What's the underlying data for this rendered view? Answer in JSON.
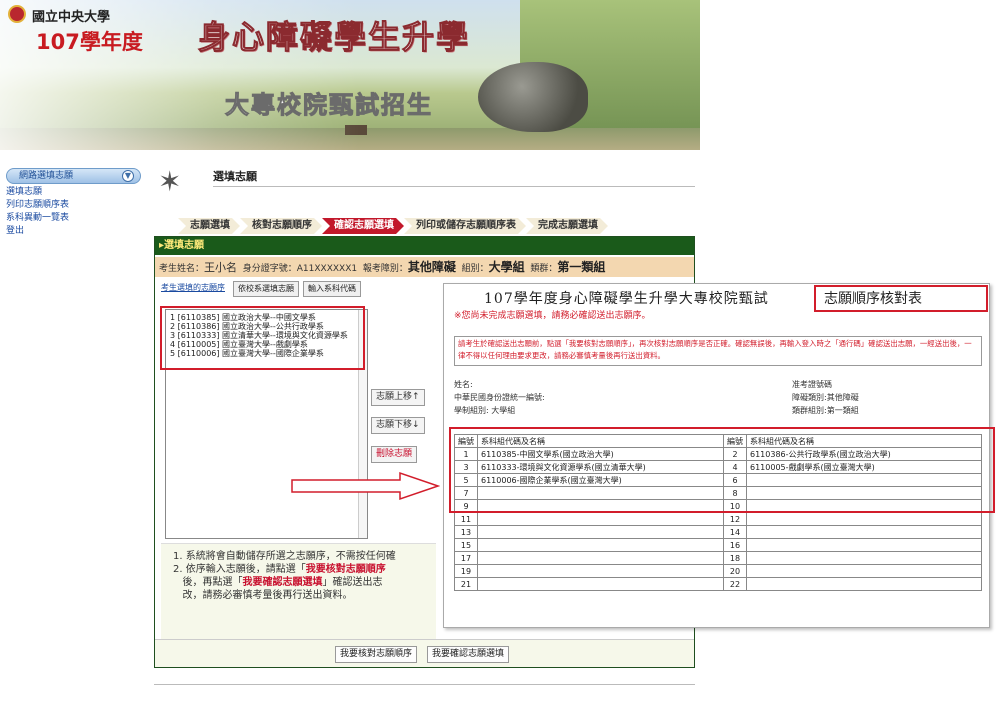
{
  "banner": {
    "university": "國立中央大學",
    "year": "107學年度",
    "main_title": "身心障礙學生升學",
    "sub_title": "大專校院甄試招生"
  },
  "sidebar": {
    "header": "網路選填志願",
    "items": [
      {
        "label": "選填志願"
      },
      {
        "label": "列印志願順序表"
      },
      {
        "label": "系科異動一覽表"
      },
      {
        "label": "登出"
      }
    ]
  },
  "section": {
    "title": "選填志願"
  },
  "steps": [
    {
      "label": "志願選填",
      "state": "done"
    },
    {
      "label": "核對志願順序",
      "state": "done"
    },
    {
      "label": "確認志願選填",
      "state": "active"
    },
    {
      "label": "列印或儲存志願順序表",
      "state": "pending"
    },
    {
      "label": "完成志願選填",
      "state": "pending"
    }
  ],
  "panel": {
    "header": "▸選填志願",
    "info": {
      "name_label": "考生姓名：",
      "name": "王小名",
      "id_label": "身分證字號：",
      "id": "A11XXXXXX1",
      "category_label": "報考障別：",
      "category": "其他障礙",
      "group_label": "組別：",
      "group": "大學組",
      "class_label": "類群：",
      "class": "第一類組"
    },
    "tabs": [
      "考生選填的志願序",
      "依校系選填志願",
      "輸入系科代碼"
    ],
    "choices": [
      "1 [6110385] 國立政治大學--中國文學系",
      "2 [6110386] 國立政治大學--公共行政學系",
      "3 [6110333] 國立清華大學--環境與文化資源學系",
      "4 [6110005] 國立臺灣大學--戲劇學系",
      "5 [6110006] 國立臺灣大學--國際企業學系"
    ],
    "buttons": {
      "up": "志願上移↑",
      "down": "志願下移↓",
      "delete": "刪除志願"
    },
    "notes": {
      "line1": "1. 系統將會自動儲存所選之志願序，不需按任何確",
      "line2_a": "2. 依序輸入志願後，請點選「",
      "line2_red": "我要核對志願順序",
      "line3_a": "後，再點選「",
      "line3_red": "我要確認志願選填",
      "line3_b": "」確認送出志",
      "line4": "改，請務必審慎考量後再行送出資料。"
    },
    "footer": {
      "check_button": "我要核對志願順序",
      "confirm_button": "我要確認志願選填"
    }
  },
  "overlay": {
    "title": "107學年度身心障礙學生升學大專校院甄試",
    "title_highlight": "志願順序核對表",
    "warning": "※您尚未完成志願選填，請務必確認送出志願序。",
    "note": "請考生於確認送出志願前，點選「我要核對志願順序」，再次核對志願順序是否正確。確認無誤後，再輸入登入時之「通行碼」確認送出志願，一經送出後，一律不得以任何理由要求更改，請務必審慎考量後再行送出資料。",
    "info": {
      "name": "姓名:",
      "exam_no": "准考證號碼",
      "id": "中華民國身份證統一編號:",
      "category": "障礙類別:其他障礙",
      "group": "學制組別: 大學組",
      "class": "類群組別:第一類組"
    },
    "table": {
      "headers": [
        "編號",
        "系科組代碼及名稱",
        "編號",
        "系科組代碼及名稱"
      ],
      "rows": [
        [
          "1",
          "6110385-中國文學系(國立政治大學)",
          "2",
          "6110386-公共行政學系(國立政治大學)"
        ],
        [
          "3",
          "6110333-環境與文化資源學系(國立清華大學)",
          "4",
          "6110005-戲劇學系(國立臺灣大學)"
        ],
        [
          "5",
          "6110006-國際企業學系(國立臺灣大學)",
          "6",
          ""
        ],
        [
          "7",
          "",
          "8",
          ""
        ],
        [
          "9",
          "",
          "10",
          ""
        ],
        [
          "11",
          "",
          "12",
          ""
        ],
        [
          "13",
          "",
          "14",
          ""
        ],
        [
          "15",
          "",
          "16",
          ""
        ],
        [
          "17",
          "",
          "18",
          ""
        ],
        [
          "19",
          "",
          "20",
          ""
        ],
        [
          "21",
          "",
          "22",
          ""
        ]
      ]
    }
  }
}
